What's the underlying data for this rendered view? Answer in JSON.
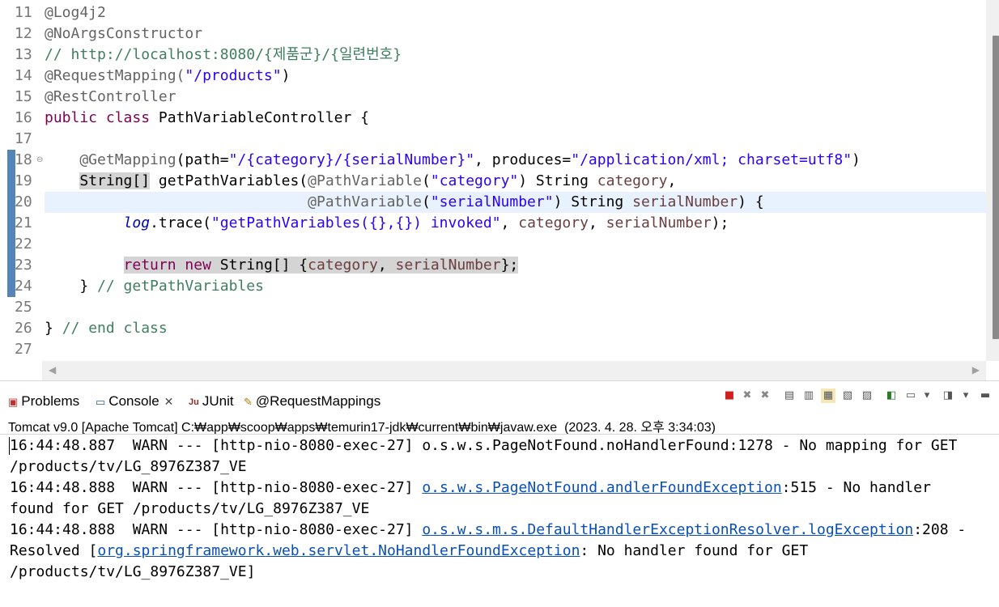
{
  "editor": {
    "lines": [
      {
        "n": "11",
        "parts": [
          {
            "t": "@Log4j2",
            "c": "ann"
          }
        ]
      },
      {
        "n": "12",
        "parts": [
          {
            "t": "@NoArgsConstructor",
            "c": "ann"
          }
        ]
      },
      {
        "n": "13",
        "parts": [
          {
            "t": "// http://localhost:8080/{제품군}/{일련번호}",
            "c": "cmt"
          }
        ]
      },
      {
        "n": "14",
        "parts": [
          {
            "t": "@RequestMapping(",
            "c": "ann"
          },
          {
            "t": "\"/products\"",
            "c": "str"
          },
          {
            "t": ")",
            "c": ""
          }
        ]
      },
      {
        "n": "15",
        "parts": [
          {
            "t": "@RestController",
            "c": "ann"
          }
        ]
      },
      {
        "n": "16",
        "parts": [
          {
            "t": "public",
            "c": "kw"
          },
          {
            "t": " ",
            "c": ""
          },
          {
            "t": "class",
            "c": "kw"
          },
          {
            "t": " PathVariableController {",
            "c": ""
          }
        ]
      },
      {
        "n": "17",
        "parts": []
      },
      {
        "n": "18",
        "parts": [
          {
            "t": "    @GetMapping",
            "c": "ann"
          },
          {
            "t": "(path=",
            "c": ""
          },
          {
            "t": "\"/{category}/{serialNumber}\"",
            "c": "str"
          },
          {
            "t": ", produces=",
            "c": ""
          },
          {
            "t": "\"/application/xml; charset=utf8\"",
            "c": "str"
          },
          {
            "t": ")",
            "c": ""
          }
        ]
      },
      {
        "n": "19",
        "parts": [
          {
            "t": "    ",
            "c": ""
          },
          {
            "t": "String[]",
            "c": "occ"
          },
          {
            "t": " getPathVariables(",
            "c": ""
          },
          {
            "t": "@PathVariable",
            "c": "ann"
          },
          {
            "t": "(",
            "c": ""
          },
          {
            "t": "\"category\"",
            "c": "str"
          },
          {
            "t": ") String ",
            "c": ""
          },
          {
            "t": "category",
            "c": "param"
          },
          {
            "t": ",",
            "c": ""
          }
        ]
      },
      {
        "n": "20",
        "parts": [
          {
            "t": "                              ",
            "c": ""
          },
          {
            "t": "@PathVariable",
            "c": "ann"
          },
          {
            "t": "(",
            "c": ""
          },
          {
            "t": "\"serialNumber\"",
            "c": "str"
          },
          {
            "t": ") String ",
            "c": ""
          },
          {
            "t": "serialNumber",
            "c": "param"
          },
          {
            "t": ") {",
            "c": ""
          }
        ]
      },
      {
        "n": "21",
        "parts": [
          {
            "t": "         ",
            "c": ""
          },
          {
            "t": "log",
            "c": "field-it"
          },
          {
            "t": ".trace(",
            "c": ""
          },
          {
            "t": "\"getPathVariables({},{}) invoked\"",
            "c": "str"
          },
          {
            "t": ", ",
            "c": ""
          },
          {
            "t": "category",
            "c": "param"
          },
          {
            "t": ", ",
            "c": ""
          },
          {
            "t": "serialNumber",
            "c": "param"
          },
          {
            "t": ");",
            "c": ""
          }
        ]
      },
      {
        "n": "22",
        "parts": []
      },
      {
        "n": "23",
        "parts": [
          {
            "t": "         ",
            "c": ""
          },
          {
            "t": "return",
            "c": "kw hl-ret"
          },
          {
            "t": " ",
            "c": "hl-ret"
          },
          {
            "t": "new",
            "c": "kw hl-ret"
          },
          {
            "t": " String[] {",
            "c": "hl-ret"
          },
          {
            "t": "category",
            "c": "param hl-ret"
          },
          {
            "t": ", ",
            "c": "hl-ret"
          },
          {
            "t": "serialNumber",
            "c": "param hl-ret"
          },
          {
            "t": "};",
            "c": "hl-ret"
          }
        ]
      },
      {
        "n": "24",
        "parts": [
          {
            "t": "    } ",
            "c": ""
          },
          {
            "t": "// getPathVariables",
            "c": "cmt"
          }
        ]
      },
      {
        "n": "25",
        "parts": []
      },
      {
        "n": "26",
        "parts": [
          {
            "t": "} ",
            "c": ""
          },
          {
            "t": "// end class",
            "c": "cmt"
          }
        ]
      },
      {
        "n": "27",
        "parts": []
      }
    ]
  },
  "panel": {
    "tabs": [
      {
        "label": "Problems",
        "icon": "problems-icon"
      },
      {
        "label": "Console",
        "icon": "console-icon"
      },
      {
        "label": "JUnit",
        "icon": "junit-icon"
      },
      {
        "label": "@RequestMappings",
        "icon": "request-mappings-icon"
      }
    ],
    "junit_icon_text": "Ju",
    "console_title": "Tomcat v9.0 [Apache Tomcat] C:₩app₩scoop₩apps₩temurin17-jdk₩current₩bin₩javaw.exe  (2023. 4. 28. 오후 3:34:03)",
    "output": {
      "l1": "16:44:48.887  WARN --- [http-nio-8080-exec-27] o.s.w.s.PageNotFound.noHandlerFound:1278 - No mapping for GET",
      "l2": "/products/tv/LG_8976Z387_VE",
      "l3_pre": "16:44:48.888  WARN --- [http-nio-8080-exec-27] ",
      "l3_link": "o.s.w.s.PageNotFound.andlerFoundException",
      "l3_post": ":515 - No handler",
      "l4": "found for GET /products/tv/LG_8976Z387_VE",
      "l5_pre": "16:44:48.888  WARN --- [http-nio-8080-exec-27] ",
      "l5_link": "o.s.w.s.m.s.DefaultHandlerExceptionResolver.logException",
      "l5_post": ":208 -",
      "l6_pre": "Resolved [",
      "l6_link": "org.springframework.web.servlet.NoHandlerFoundException",
      "l6_post": ": No handler found for GET",
      "l7": "/products/tv/LG_8976Z387_VE]"
    }
  }
}
